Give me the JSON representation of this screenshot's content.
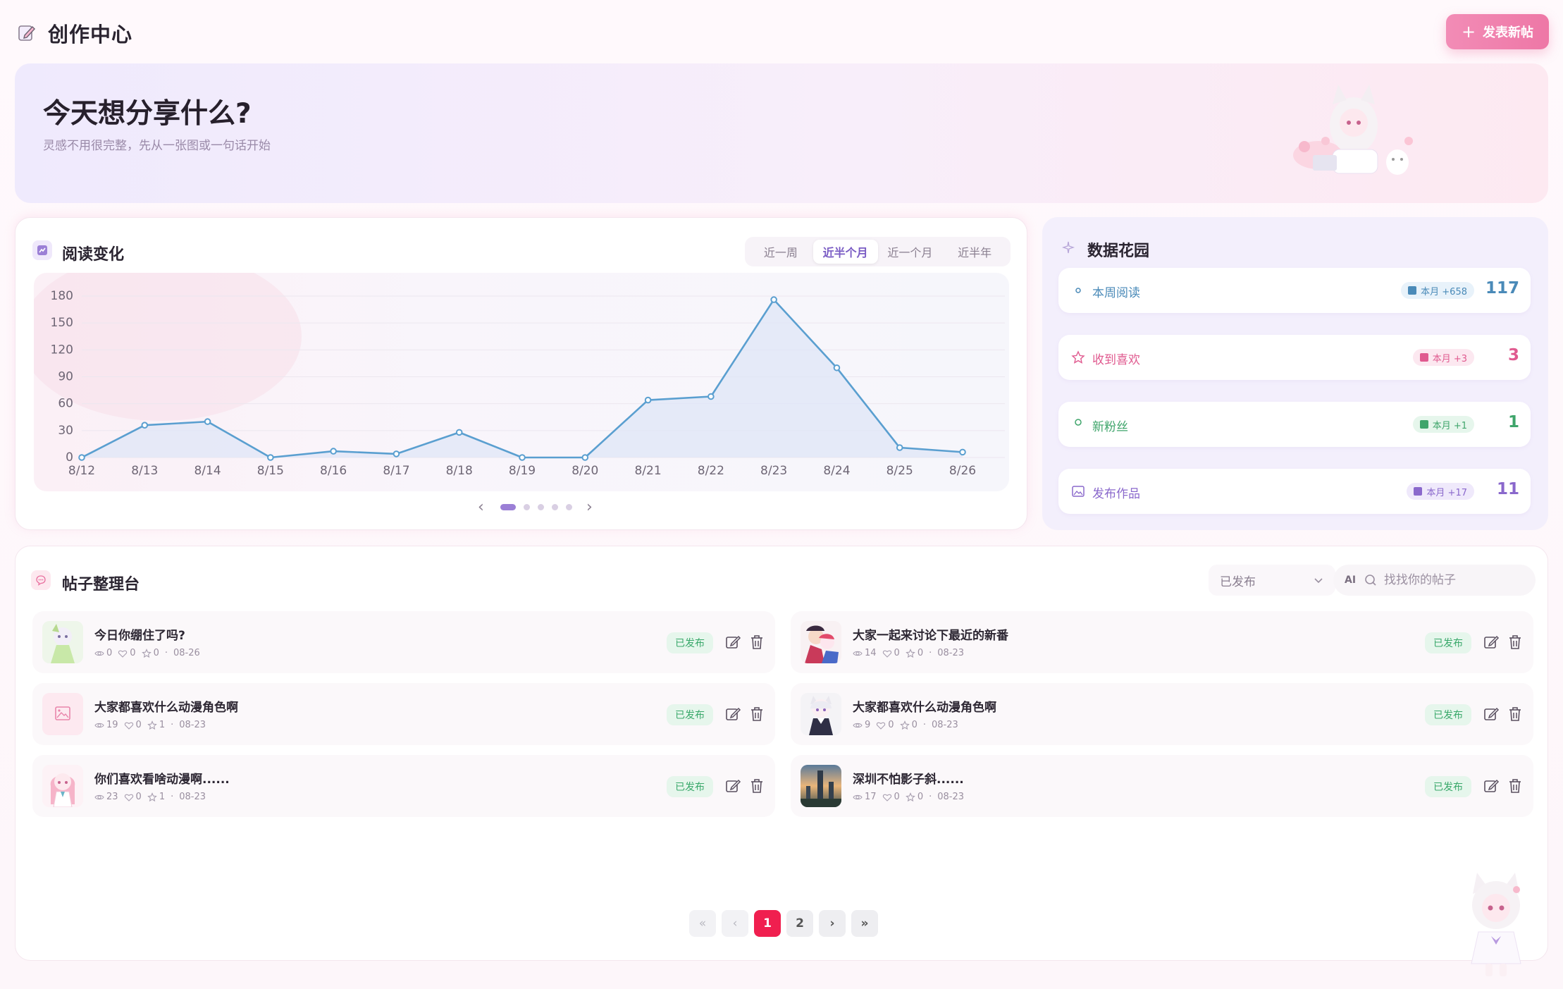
{
  "header": {
    "title": "创作中心",
    "new_post_label": "发表新帖"
  },
  "banner": {
    "title": "今天想分享什么?",
    "subtitle": "灵感不用很完整，先从一张图或一句话开始"
  },
  "reading": {
    "title": "阅读变化",
    "ranges": [
      "近一周",
      "近半个月",
      "近一个月",
      "近半年"
    ],
    "active_range": "近半个月"
  },
  "chart_data": {
    "type": "area",
    "categories": [
      "8/12",
      "8/13",
      "8/14",
      "8/15",
      "8/16",
      "8/17",
      "8/18",
      "8/19",
      "8/20",
      "8/21",
      "8/22",
      "8/23",
      "8/24",
      "8/25",
      "8/26"
    ],
    "series": [
      {
        "values": [
          0,
          36,
          40,
          0,
          7,
          4,
          28,
          0,
          0,
          64,
          68,
          176,
          100,
          11,
          6
        ]
      }
    ],
    "yticks": [
      0,
      30,
      60,
      90,
      120,
      150,
      180
    ],
    "ylim": [
      0,
      180
    ],
    "grid": true,
    "colors": {
      "line": "#5a9fd0",
      "fill": "#dfe6f7"
    }
  },
  "garden": {
    "title": "数据花园",
    "stats": [
      {
        "label": "本周阅读",
        "badge": "本月 +658",
        "value": "117",
        "icon": "eye-icon",
        "color": "#4a8ab8",
        "badge_bg": "#e8f2fa"
      },
      {
        "label": "收到喜欢",
        "badge": "本月 +3",
        "value": "3",
        "icon": "star-icon",
        "color": "#e05a8f",
        "badge_bg": "#fce8f0"
      },
      {
        "label": "新粉丝",
        "badge": "本月 +1",
        "value": "1",
        "icon": "user-icon",
        "color": "#3fa56b",
        "badge_bg": "#e6f6ec"
      },
      {
        "label": "发布作品",
        "badge": "本月 +17",
        "value": "11",
        "icon": "image-icon",
        "color": "#8a68cc",
        "badge_bg": "#efe9fb"
      }
    ]
  },
  "posts": {
    "title": "帖子整理台",
    "filter": "已发布",
    "search_placeholder": "找找你的帖子",
    "ai_label": "AI",
    "status_label": "已发布",
    "items": [
      {
        "title": "今日你绷住了吗?",
        "views": "0",
        "likes": "0",
        "stars": "0",
        "date": "08-26"
      },
      {
        "title": "大家一起来讨论下最近的新番",
        "views": "14",
        "likes": "0",
        "stars": "0",
        "date": "08-23"
      },
      {
        "title": "大家都喜欢什么动漫角色啊",
        "views": "19",
        "likes": "0",
        "stars": "1",
        "date": "08-23"
      },
      {
        "title": "大家都喜欢什么动漫角色啊",
        "views": "9",
        "likes": "0",
        "stars": "0",
        "date": "08-23"
      },
      {
        "title": "你们喜欢看啥动漫啊......",
        "views": "23",
        "likes": "0",
        "stars": "1",
        "date": "08-23"
      },
      {
        "title": "深圳不怕影子斜......",
        "views": "17",
        "likes": "0",
        "stars": "0",
        "date": "08-23"
      }
    ]
  },
  "pagination": {
    "first": "«",
    "prev": "‹",
    "pages": [
      "1",
      "2"
    ],
    "current": "1",
    "next": "›",
    "last": "»"
  }
}
